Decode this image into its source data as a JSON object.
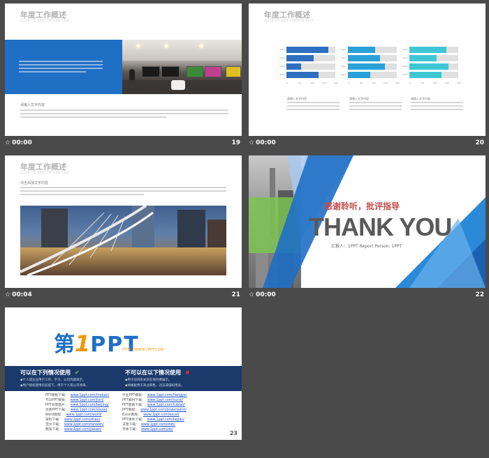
{
  "slides": [
    {
      "number": "19",
      "time": "00:00",
      "title": "年度工作概述",
      "subtitle": "CLICK TO ADD CAPTION TEXT",
      "caption": "请输入文字内容"
    },
    {
      "number": "20",
      "time": "00:00",
      "title": "年度工作概述",
      "subtitle": "CLICK TO ADD CAPTION TEXT",
      "captions": [
        "请输入文字内容",
        "请输入文字内容",
        "请输入文字内容"
      ],
      "chart_data": [
        {
          "type": "bar",
          "categories": [
            "2012",
            "2013",
            "2014",
            "2015"
          ],
          "values": [
            85,
            55,
            30,
            65
          ],
          "color": "#2e6fbf",
          "ticks": [
            "0",
            "50",
            "100",
            "150",
            "200"
          ]
        },
        {
          "type": "bar",
          "categories": [
            "2012",
            "2013",
            "2014",
            "2015"
          ],
          "values": [
            55,
            65,
            75,
            45
          ],
          "color": "#2aa0d8",
          "ticks": [
            "0",
            "50",
            "100",
            "150",
            "200"
          ]
        },
        {
          "type": "bar",
          "categories": [
            "2012",
            "2013",
            "2014",
            "2015"
          ],
          "values": [
            75,
            55,
            80,
            65
          ],
          "color": "#3fc6d4",
          "ticks": [
            "0",
            "50",
            "100",
            "150",
            "200"
          ]
        }
      ]
    },
    {
      "number": "21",
      "time": "00:04",
      "title": "年度工作概述",
      "subtitle": "CLICK TO ADD CAPTION TEXT",
      "caption": "点击添加文字内容"
    },
    {
      "number": "22",
      "time": "00:00",
      "thanks_cn": "感谢聆听，批评指导",
      "thanks_en": "THANK YOU",
      "reporter": "汇报人：1PPT   Report Person: 1PPT"
    },
    {
      "number": "23",
      "logo_text": "第1PPT",
      "logo_url": "HTTP://WWW.1PPT.COM",
      "can_use": "可以在下列情况使用",
      "cannot_use": "不可以在以下情况使用",
      "can_items": [
        "◆个人或企业用于工作、学习、公司内部演示。",
        "◆用户授权使用的前提下，用于个人或公司项目。"
      ],
      "cannot_items": [
        "◆用于任何形式的在线付费展示。",
        "◆将模板用于商业转售、违法或侵权用途。"
      ],
      "links_left": [
        [
          "PPT模板下载：",
          "www.1ppt.com/moban/"
        ],
        [
          "节日PPT模板：",
          "www.1ppt.com/jieri/"
        ],
        [
          "PPT背景图片：",
          "www.1ppt.com/beijing/"
        ],
        [
          "优秀PPT下载：",
          "www.1ppt.com/xiazai/"
        ],
        [
          "Word教程：",
          "www.1ppt.com/word/"
        ],
        [
          "资料下载：",
          "www.1ppt.com/ziliao/"
        ],
        [
          "范文下载：",
          "www.1ppt.com/fanwen/"
        ],
        [
          "教案下载：",
          "www.1ppt.com/jiaoan/"
        ]
      ],
      "links_right": [
        [
          "行业PPT模板：",
          "www.1ppt.com/hangye/"
        ],
        [
          "PPT素材下载：",
          "www.1ppt.com/sucai/"
        ],
        [
          "PPT图表下载：",
          "www.1ppt.com/tubiao/"
        ],
        [
          "PPT教程：",
          "www.1ppt.com/powerpoint/"
        ],
        [
          "Excel教程：",
          "www.1ppt.com/excel/"
        ],
        [
          "PPT课件下载：",
          "www.1ppt.com/kejian/"
        ],
        [
          "试卷下载：",
          "www.1ppt.com/shiti/"
        ],
        [
          "字体下载：",
          "www.1ppt.com/ziti/"
        ]
      ]
    }
  ]
}
